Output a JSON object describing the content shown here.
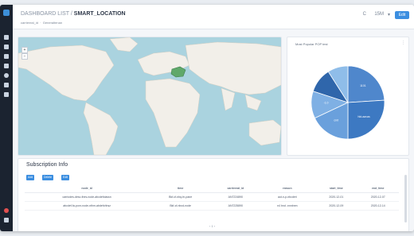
{
  "breadcrumb": {
    "parent": "DASHBOARD LIST /",
    "current": "SMART_LOCATION"
  },
  "filter": {
    "label": "carriereal_id",
    "value": "Generaltenan"
  },
  "toolbar": {
    "refresh": "C",
    "time": "15M",
    "edit": "Edit"
  },
  "map": {
    "label": "Map",
    "zoom_in": "+",
    "zoom_out": "−"
  },
  "pie": {
    "title": "Most Popular POP test",
    "labels": [
      "1101",
      "hkt-aavas",
      "cmt",
      "-1.0"
    ]
  },
  "subscription": {
    "title": "Subscription Info",
    "buttons": [
      "Add",
      "Delete",
      "Edit"
    ],
    "columns": [
      "node_id",
      "time",
      "carriereal_id",
      "reason",
      "start_time",
      "end_time"
    ],
    "rows": [
      [
        "carriodes-desc-thes-node-abcdefclassn",
        "Bkf-cf-nbq-fn-pane",
        "AN7224890",
        "aut-n-p-nbcderi",
        "2020-12-01",
        "2020-12-07"
      ],
      [
        "abcdef-fa-ponr-node-nthm-abdefchhsz",
        "Bkf-cf-nbcd-node",
        "AN7225890",
        "n4 bnd -nnnbnm",
        "2020-12-09",
        "2020-12-14"
      ]
    ],
    "pager": "‹ 1 ›"
  },
  "colors": {
    "accent": "#3b8ee0",
    "pie": [
      "#4f87cc",
      "#3d79c2",
      "#6aa0dc",
      "#7fb0e4",
      "#2f66ab",
      "#8fbde9"
    ]
  },
  "chart_data": {
    "type": "pie",
    "title": "Most Popular POP test",
    "labels": [
      "1101",
      "hkt-aavas",
      "cmt",
      "-1.0"
    ],
    "values": [
      24,
      26,
      18,
      12,
      11,
      9
    ]
  }
}
